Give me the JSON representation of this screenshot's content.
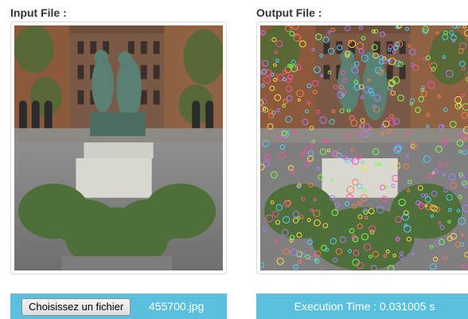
{
  "input_panel": {
    "label": "Input File :",
    "image_description_icon": "statue-courtyard-photo"
  },
  "output_panel": {
    "label": "Output File :",
    "image_description_icon": "statue-courtyard-photo-with-keypoints"
  },
  "upload": {
    "button_label": "Choisissez un fichier",
    "file_name": "455700.jpg"
  },
  "result": {
    "execution_time": "Execution Time : 0.031005 s"
  },
  "colors": {
    "accent": "#5bc0de",
    "border": "#d8d8d8"
  }
}
